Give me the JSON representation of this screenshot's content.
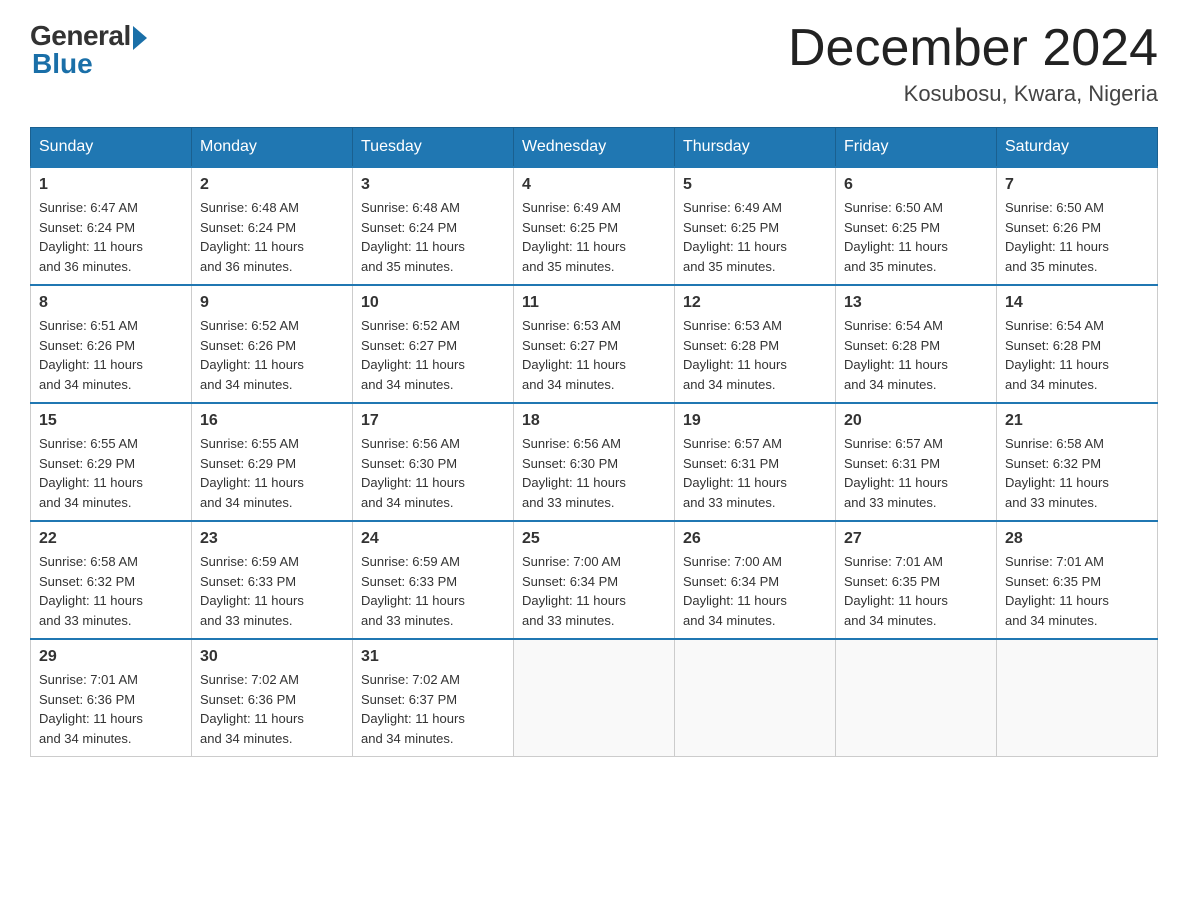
{
  "header": {
    "logo_general": "General",
    "logo_blue": "Blue",
    "month_title": "December 2024",
    "location": "Kosubosu, Kwara, Nigeria"
  },
  "days_of_week": [
    "Sunday",
    "Monday",
    "Tuesday",
    "Wednesday",
    "Thursday",
    "Friday",
    "Saturday"
  ],
  "weeks": [
    [
      {
        "day": "1",
        "sunrise": "6:47 AM",
        "sunset": "6:24 PM",
        "daylight": "11 hours and 36 minutes."
      },
      {
        "day": "2",
        "sunrise": "6:48 AM",
        "sunset": "6:24 PM",
        "daylight": "11 hours and 36 minutes."
      },
      {
        "day": "3",
        "sunrise": "6:48 AM",
        "sunset": "6:24 PM",
        "daylight": "11 hours and 35 minutes."
      },
      {
        "day": "4",
        "sunrise": "6:49 AM",
        "sunset": "6:25 PM",
        "daylight": "11 hours and 35 minutes."
      },
      {
        "day": "5",
        "sunrise": "6:49 AM",
        "sunset": "6:25 PM",
        "daylight": "11 hours and 35 minutes."
      },
      {
        "day": "6",
        "sunrise": "6:50 AM",
        "sunset": "6:25 PM",
        "daylight": "11 hours and 35 minutes."
      },
      {
        "day": "7",
        "sunrise": "6:50 AM",
        "sunset": "6:26 PM",
        "daylight": "11 hours and 35 minutes."
      }
    ],
    [
      {
        "day": "8",
        "sunrise": "6:51 AM",
        "sunset": "6:26 PM",
        "daylight": "11 hours and 34 minutes."
      },
      {
        "day": "9",
        "sunrise": "6:52 AM",
        "sunset": "6:26 PM",
        "daylight": "11 hours and 34 minutes."
      },
      {
        "day": "10",
        "sunrise": "6:52 AM",
        "sunset": "6:27 PM",
        "daylight": "11 hours and 34 minutes."
      },
      {
        "day": "11",
        "sunrise": "6:53 AM",
        "sunset": "6:27 PM",
        "daylight": "11 hours and 34 minutes."
      },
      {
        "day": "12",
        "sunrise": "6:53 AM",
        "sunset": "6:28 PM",
        "daylight": "11 hours and 34 minutes."
      },
      {
        "day": "13",
        "sunrise": "6:54 AM",
        "sunset": "6:28 PM",
        "daylight": "11 hours and 34 minutes."
      },
      {
        "day": "14",
        "sunrise": "6:54 AM",
        "sunset": "6:28 PM",
        "daylight": "11 hours and 34 minutes."
      }
    ],
    [
      {
        "day": "15",
        "sunrise": "6:55 AM",
        "sunset": "6:29 PM",
        "daylight": "11 hours and 34 minutes."
      },
      {
        "day": "16",
        "sunrise": "6:55 AM",
        "sunset": "6:29 PM",
        "daylight": "11 hours and 34 minutes."
      },
      {
        "day": "17",
        "sunrise": "6:56 AM",
        "sunset": "6:30 PM",
        "daylight": "11 hours and 34 minutes."
      },
      {
        "day": "18",
        "sunrise": "6:56 AM",
        "sunset": "6:30 PM",
        "daylight": "11 hours and 33 minutes."
      },
      {
        "day": "19",
        "sunrise": "6:57 AM",
        "sunset": "6:31 PM",
        "daylight": "11 hours and 33 minutes."
      },
      {
        "day": "20",
        "sunrise": "6:57 AM",
        "sunset": "6:31 PM",
        "daylight": "11 hours and 33 minutes."
      },
      {
        "day": "21",
        "sunrise": "6:58 AM",
        "sunset": "6:32 PM",
        "daylight": "11 hours and 33 minutes."
      }
    ],
    [
      {
        "day": "22",
        "sunrise": "6:58 AM",
        "sunset": "6:32 PM",
        "daylight": "11 hours and 33 minutes."
      },
      {
        "day": "23",
        "sunrise": "6:59 AM",
        "sunset": "6:33 PM",
        "daylight": "11 hours and 33 minutes."
      },
      {
        "day": "24",
        "sunrise": "6:59 AM",
        "sunset": "6:33 PM",
        "daylight": "11 hours and 33 minutes."
      },
      {
        "day": "25",
        "sunrise": "7:00 AM",
        "sunset": "6:34 PM",
        "daylight": "11 hours and 33 minutes."
      },
      {
        "day": "26",
        "sunrise": "7:00 AM",
        "sunset": "6:34 PM",
        "daylight": "11 hours and 34 minutes."
      },
      {
        "day": "27",
        "sunrise": "7:01 AM",
        "sunset": "6:35 PM",
        "daylight": "11 hours and 34 minutes."
      },
      {
        "day": "28",
        "sunrise": "7:01 AM",
        "sunset": "6:35 PM",
        "daylight": "11 hours and 34 minutes."
      }
    ],
    [
      {
        "day": "29",
        "sunrise": "7:01 AM",
        "sunset": "6:36 PM",
        "daylight": "11 hours and 34 minutes."
      },
      {
        "day": "30",
        "sunrise": "7:02 AM",
        "sunset": "6:36 PM",
        "daylight": "11 hours and 34 minutes."
      },
      {
        "day": "31",
        "sunrise": "7:02 AM",
        "sunset": "6:37 PM",
        "daylight": "11 hours and 34 minutes."
      },
      null,
      null,
      null,
      null
    ]
  ],
  "labels": {
    "sunrise_prefix": "Sunrise: ",
    "sunset_prefix": "Sunset: ",
    "daylight_prefix": "Daylight: "
  }
}
